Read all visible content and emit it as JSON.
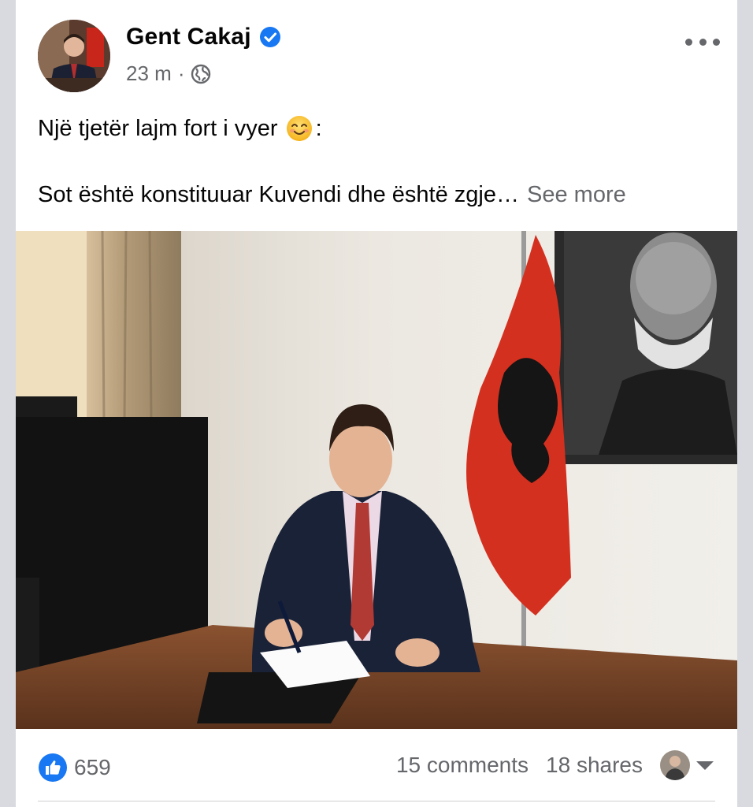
{
  "post": {
    "author": "Gent Cakaj",
    "verified": true,
    "time": "23 m",
    "separator": "·",
    "privacy_icon": "globe-icon",
    "line1": "Një tjetër lajm fort i vyer",
    "line1_suffix": ":",
    "emoji": "smiling-face-emoji",
    "line2": "Sot është konstituuar Kuvendi dhe është zgje…",
    "see_more": "See more"
  },
  "footer": {
    "like_count": "659",
    "comments": "15 comments",
    "shares": "18 shares"
  },
  "colors": {
    "accent": "#1877f2",
    "secondary_text": "#65676b",
    "flag_red": "#d4301f"
  }
}
